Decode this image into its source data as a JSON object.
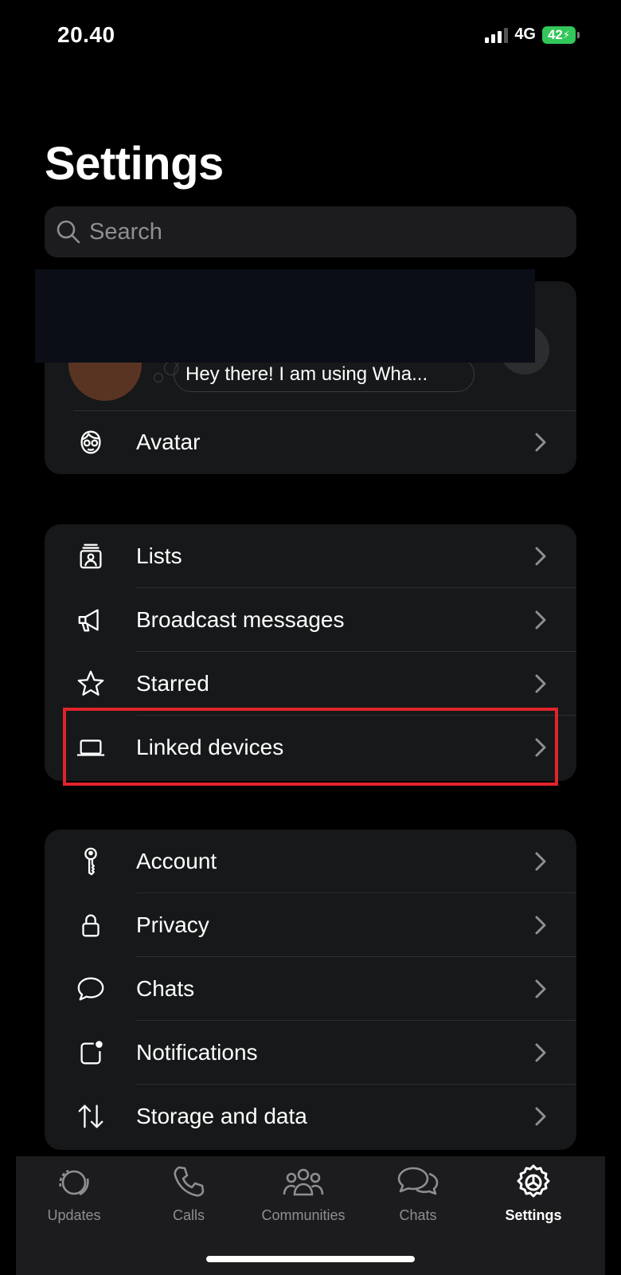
{
  "status_bar": {
    "time": "20.40",
    "network": "4G",
    "battery": "42"
  },
  "page_title": "Settings",
  "search": {
    "placeholder": "Search"
  },
  "profile": {
    "status_text": "Hey there! I am using Wha..."
  },
  "profile_rows": [
    {
      "label": "Avatar",
      "icon": "avatar-icon"
    }
  ],
  "section_two": [
    {
      "label": "Lists",
      "icon": "lists-icon"
    },
    {
      "label": "Broadcast messages",
      "icon": "megaphone-icon"
    },
    {
      "label": "Starred",
      "icon": "star-icon"
    },
    {
      "label": "Linked devices",
      "icon": "laptop-icon"
    }
  ],
  "section_three": [
    {
      "label": "Account",
      "icon": "key-icon"
    },
    {
      "label": "Privacy",
      "icon": "lock-icon"
    },
    {
      "label": "Chats",
      "icon": "chat-bubble-icon"
    },
    {
      "label": "Notifications",
      "icon": "notification-icon"
    },
    {
      "label": "Storage and data",
      "icon": "storage-arrows-icon"
    }
  ],
  "tabs": [
    {
      "label": "Updates",
      "icon": "updates-icon",
      "active": false
    },
    {
      "label": "Calls",
      "icon": "phone-icon",
      "active": false
    },
    {
      "label": "Communities",
      "icon": "communities-icon",
      "active": false
    },
    {
      "label": "Chats",
      "icon": "chats-tab-icon",
      "active": false
    },
    {
      "label": "Settings",
      "icon": "settings-gear-icon",
      "active": true
    }
  ],
  "colors": {
    "highlight": "#e0242b",
    "battery": "#32c759",
    "background": "#000000",
    "card": "#161819"
  }
}
